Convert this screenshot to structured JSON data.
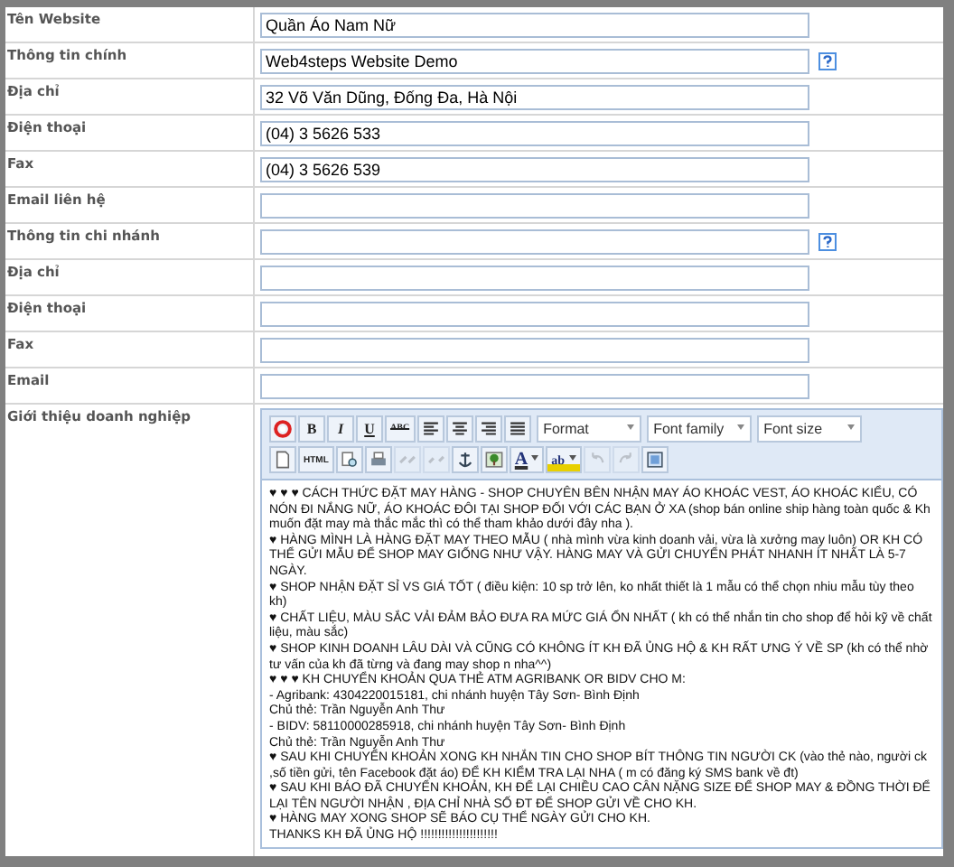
{
  "fields": [
    {
      "label": "Tên Website",
      "value": "Quần Áo Nam Nữ",
      "help": false
    },
    {
      "label": "Thông tin chính",
      "value": "Web4steps Website Demo",
      "help": true
    },
    {
      "label": "Địa chỉ",
      "value": "32 Võ Văn Dũng, Đống Đa, Hà Nội",
      "help": false
    },
    {
      "label": "Điện thoại",
      "value": "(04) 3 5626 533",
      "help": false
    },
    {
      "label": "Fax",
      "value": "(04) 3 5626 539",
      "help": false
    },
    {
      "label": "Email liên hệ",
      "help": false
    },
    {
      "label": "Thông tin chi nhánh",
      "help": true
    },
    {
      "label": "Địa chỉ",
      "help": false
    },
    {
      "label": "Điện thoại",
      "help": false
    },
    {
      "label": "Fax",
      "help": false
    },
    {
      "label": "Email",
      "help": false
    }
  ],
  "editor": {
    "label": "Giới thiệu doanh nghiệp",
    "toolbar_rows": [
      [
        {
          "kind": "lifebuoy"
        },
        {
          "kind": "bold",
          "label": "B"
        },
        {
          "kind": "italic",
          "label": "I"
        },
        {
          "kind": "underline",
          "label": "U"
        },
        {
          "kind": "strikethrough",
          "label": "ABC"
        },
        {
          "kind": "align-left"
        },
        {
          "kind": "align-center"
        },
        {
          "kind": "align-right"
        },
        {
          "kind": "align-justify"
        },
        {
          "kind": "select",
          "label": "Format"
        },
        {
          "kind": "select",
          "label": "Font family"
        },
        {
          "kind": "select",
          "label": "Font size"
        }
      ],
      [
        {
          "kind": "new-document",
          "disabled": false
        },
        {
          "kind": "html",
          "label": "HTML",
          "disabled": false
        },
        {
          "kind": "find",
          "disabled": false
        },
        {
          "kind": "print",
          "disabled": false
        },
        {
          "kind": "link",
          "disabled": true
        },
        {
          "kind": "unlink",
          "disabled": true
        },
        {
          "kind": "anchor",
          "disabled": false
        },
        {
          "kind": "image",
          "disabled": false
        },
        {
          "kind": "text-color",
          "label": "A",
          "disabled": false
        },
        {
          "kind": "highlight-color",
          "label": "ab",
          "disabled": false
        },
        {
          "kind": "undo",
          "disabled": true
        },
        {
          "kind": "redo",
          "disabled": true
        },
        {
          "kind": "fullscreen",
          "disabled": false
        }
      ]
    ],
    "content": [
      "♥ ♥ ♥ CÁCH THỨC ĐẶT MAY HÀNG - SHOP CHUYÊN BÊN NHẬN MAY ÁO KHOÁC VEST, ÁO KHOÁC KIỂU, CÓ NÓN ĐI NẮNG NỮ, ÁO KHOÁC ĐÔI TẠI SHOP ĐỐI VỚI CÁC BẠN Ở XA (shop bán online ship hàng toàn quốc & Kh muốn đặt may mà thắc mắc thì có thể tham khảo dưới đây nha ).",
      "♥ HÀNG MÌNH LÀ HÀNG ĐẶT MAY THEO MẪU ( nhà mình vừa kinh doanh vải, vừa là xưởng may luôn) OR KH CÓ THỂ GỬI MẪU ĐỂ SHOP MAY GIỐNG NHƯ VẬY. HÀNG MAY VÀ GỬI CHUYỂN PHÁT NHANH ÍT NHẤT LÀ 5-7 NGÀY.",
      "♥ SHOP NHẬN ĐẶT SỈ VS GIÁ TỐT ( điều kiện: 10 sp trở lên, ko nhất thiết là 1 mẫu có thể chọn nhiu mẫu tùy theo kh)",
      "♥ CHẤT LIỆU, MÀU SẮC VẢI ĐẢM BẢO ĐƯA RA MỨC GIÁ ỔN NHẤT ( kh có thể nhắn tin cho shop để hỏi kỹ về chất liệu, màu sắc)",
      "♥ SHOP KINH DOANH LÂU DÀI VÀ CŨNG CÓ KHÔNG ÍT KH ĐÃ ỦNG HỘ & KH RẤT ƯNG Ý VỀ SP (kh có thể nhờ tư vấn của kh đã từng và đang may shop n nha^^)",
      "♥ ♥ ♥ KH CHUYỂN KHOẢN QUA THẺ ATM AGRIBANK OR BIDV CHO M:",
      "- Agribank: 4304220015181, chi nhánh huyện Tây Sơn- Bình Định",
      "Chủ thẻ: Trần Nguyễn Anh Thư",
      "- BIDV: 58110000285918, chi nhánh huyện Tây Sơn- Bình Định",
      "Chủ thẻ: Trần Nguyễn Anh Thư",
      "♥ SAU KHI CHUYỂN KHOẢN XONG KH NHẮN TIN CHO SHOP BÍT THÔNG TIN NGƯỜI CK (vào thẻ nào, người ck ,số tiền gửi, tên Facebook đặt áo) ĐỂ KH KIỂM TRA LẠI NHA ( m có đăng ký SMS bank về đt)",
      "♥ SAU KHI BÁO ĐÃ CHUYỂN KHOẢN, KH ĐỂ LẠI CHIỀU CAO CÂN NẶNG SIZE ĐỂ SHOP MAY & ĐỒNG THỜI ĐỂ LẠI TÊN NGƯỜI NHẬN , ĐỊA CHỈ NHÀ SỐ ĐT ĐỂ SHOP GỬI VỀ CHO KH.",
      "♥ HÀNG MAY XONG SHOP SẼ BÁO CỤ THỂ NGÀY GỬI CHO KH.",
      "THANKS KH ĐÃ ỦNG HỘ !!!!!!!!!!!!!!!!!!!!!!"
    ]
  }
}
